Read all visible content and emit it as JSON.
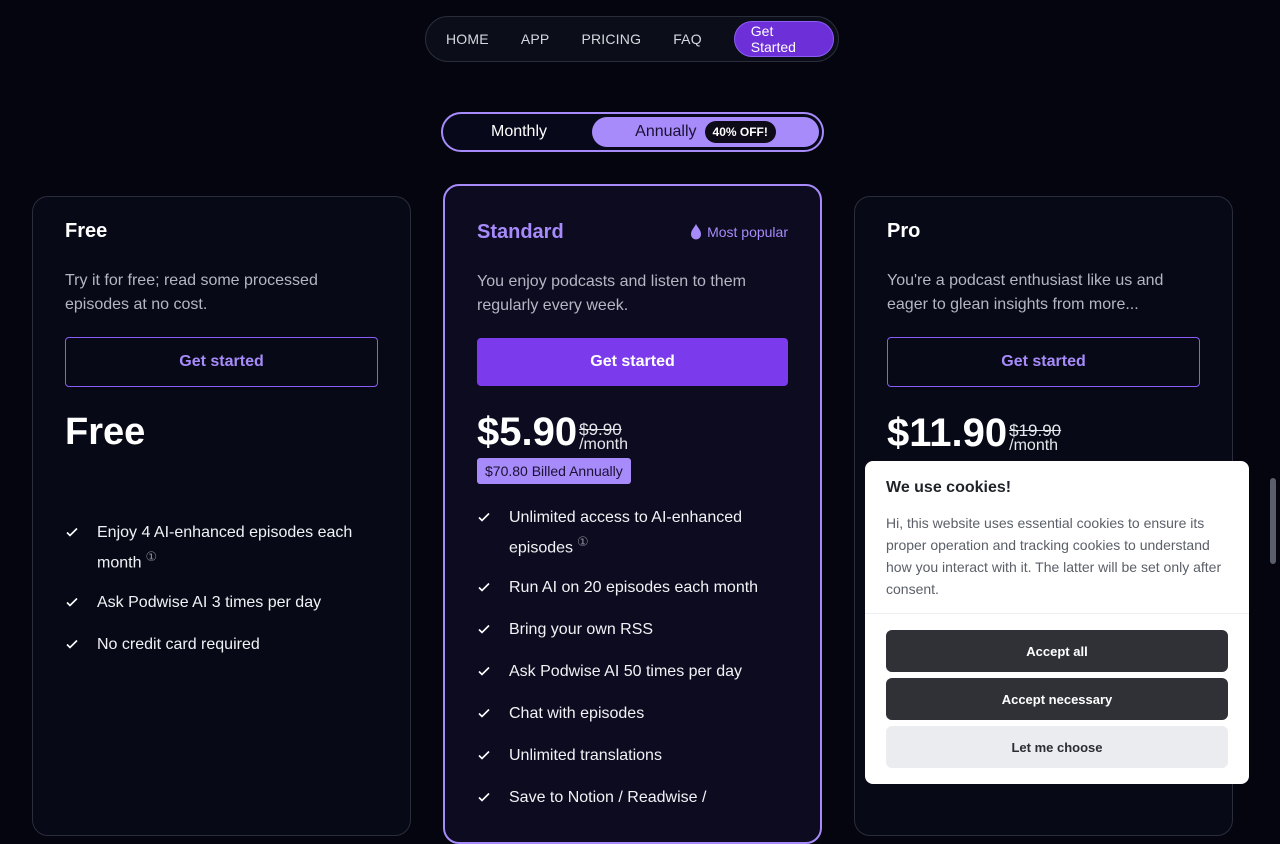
{
  "nav": {
    "links": [
      "HOME",
      "APP",
      "PRICING",
      "FAQ"
    ],
    "cta": "Get Started"
  },
  "billing_toggle": {
    "monthly": "Monthly",
    "annually": "Annually",
    "discount_badge": "40% OFF!",
    "selected": "Annually"
  },
  "plans": {
    "free": {
      "title": "Free",
      "description": "Try it for free; read some processed episodes at no cost.",
      "button": "Get started",
      "price": "Free",
      "features": [
        "Enjoy 4 AI-enhanced episodes each month",
        "Ask Podwise AI 3 times per day",
        "No credit card required"
      ]
    },
    "standard": {
      "title": "Standard",
      "badge": "Most popular",
      "description": "You enjoy podcasts and listen to them regularly every week.",
      "button": "Get started",
      "price": "$5.90",
      "old_price": "$9.90",
      "per": "/month",
      "billed": "$70.80 Billed Annually",
      "features": [
        "Unlimited access to AI-enhanced episodes",
        "Run AI on 20 episodes each month",
        "Bring your own RSS",
        "Ask Podwise AI 50 times per day",
        "Chat with episodes",
        "Unlimited translations",
        "Save to Notion / Readwise /"
      ]
    },
    "pro": {
      "title": "Pro",
      "description": "You're a podcast enthusiast like us and eager to glean insights from more...",
      "button": "Get started",
      "price": "$11.90",
      "old_price": "$19.90",
      "per": "/month"
    }
  },
  "cookie": {
    "title": "We use cookies!",
    "text": "Hi, this website uses essential cookies to ensure its proper operation and tracking cookies to understand how you interact with it. The latter will be set only after consent.",
    "accept_all": "Accept all",
    "accept_necessary": "Accept necessary",
    "let_me_choose": "Let me choose"
  },
  "info_glyph": "①",
  "colors": {
    "background": "#04050f",
    "accent": "#7c3aed",
    "accent_light": "#a78bfa"
  }
}
